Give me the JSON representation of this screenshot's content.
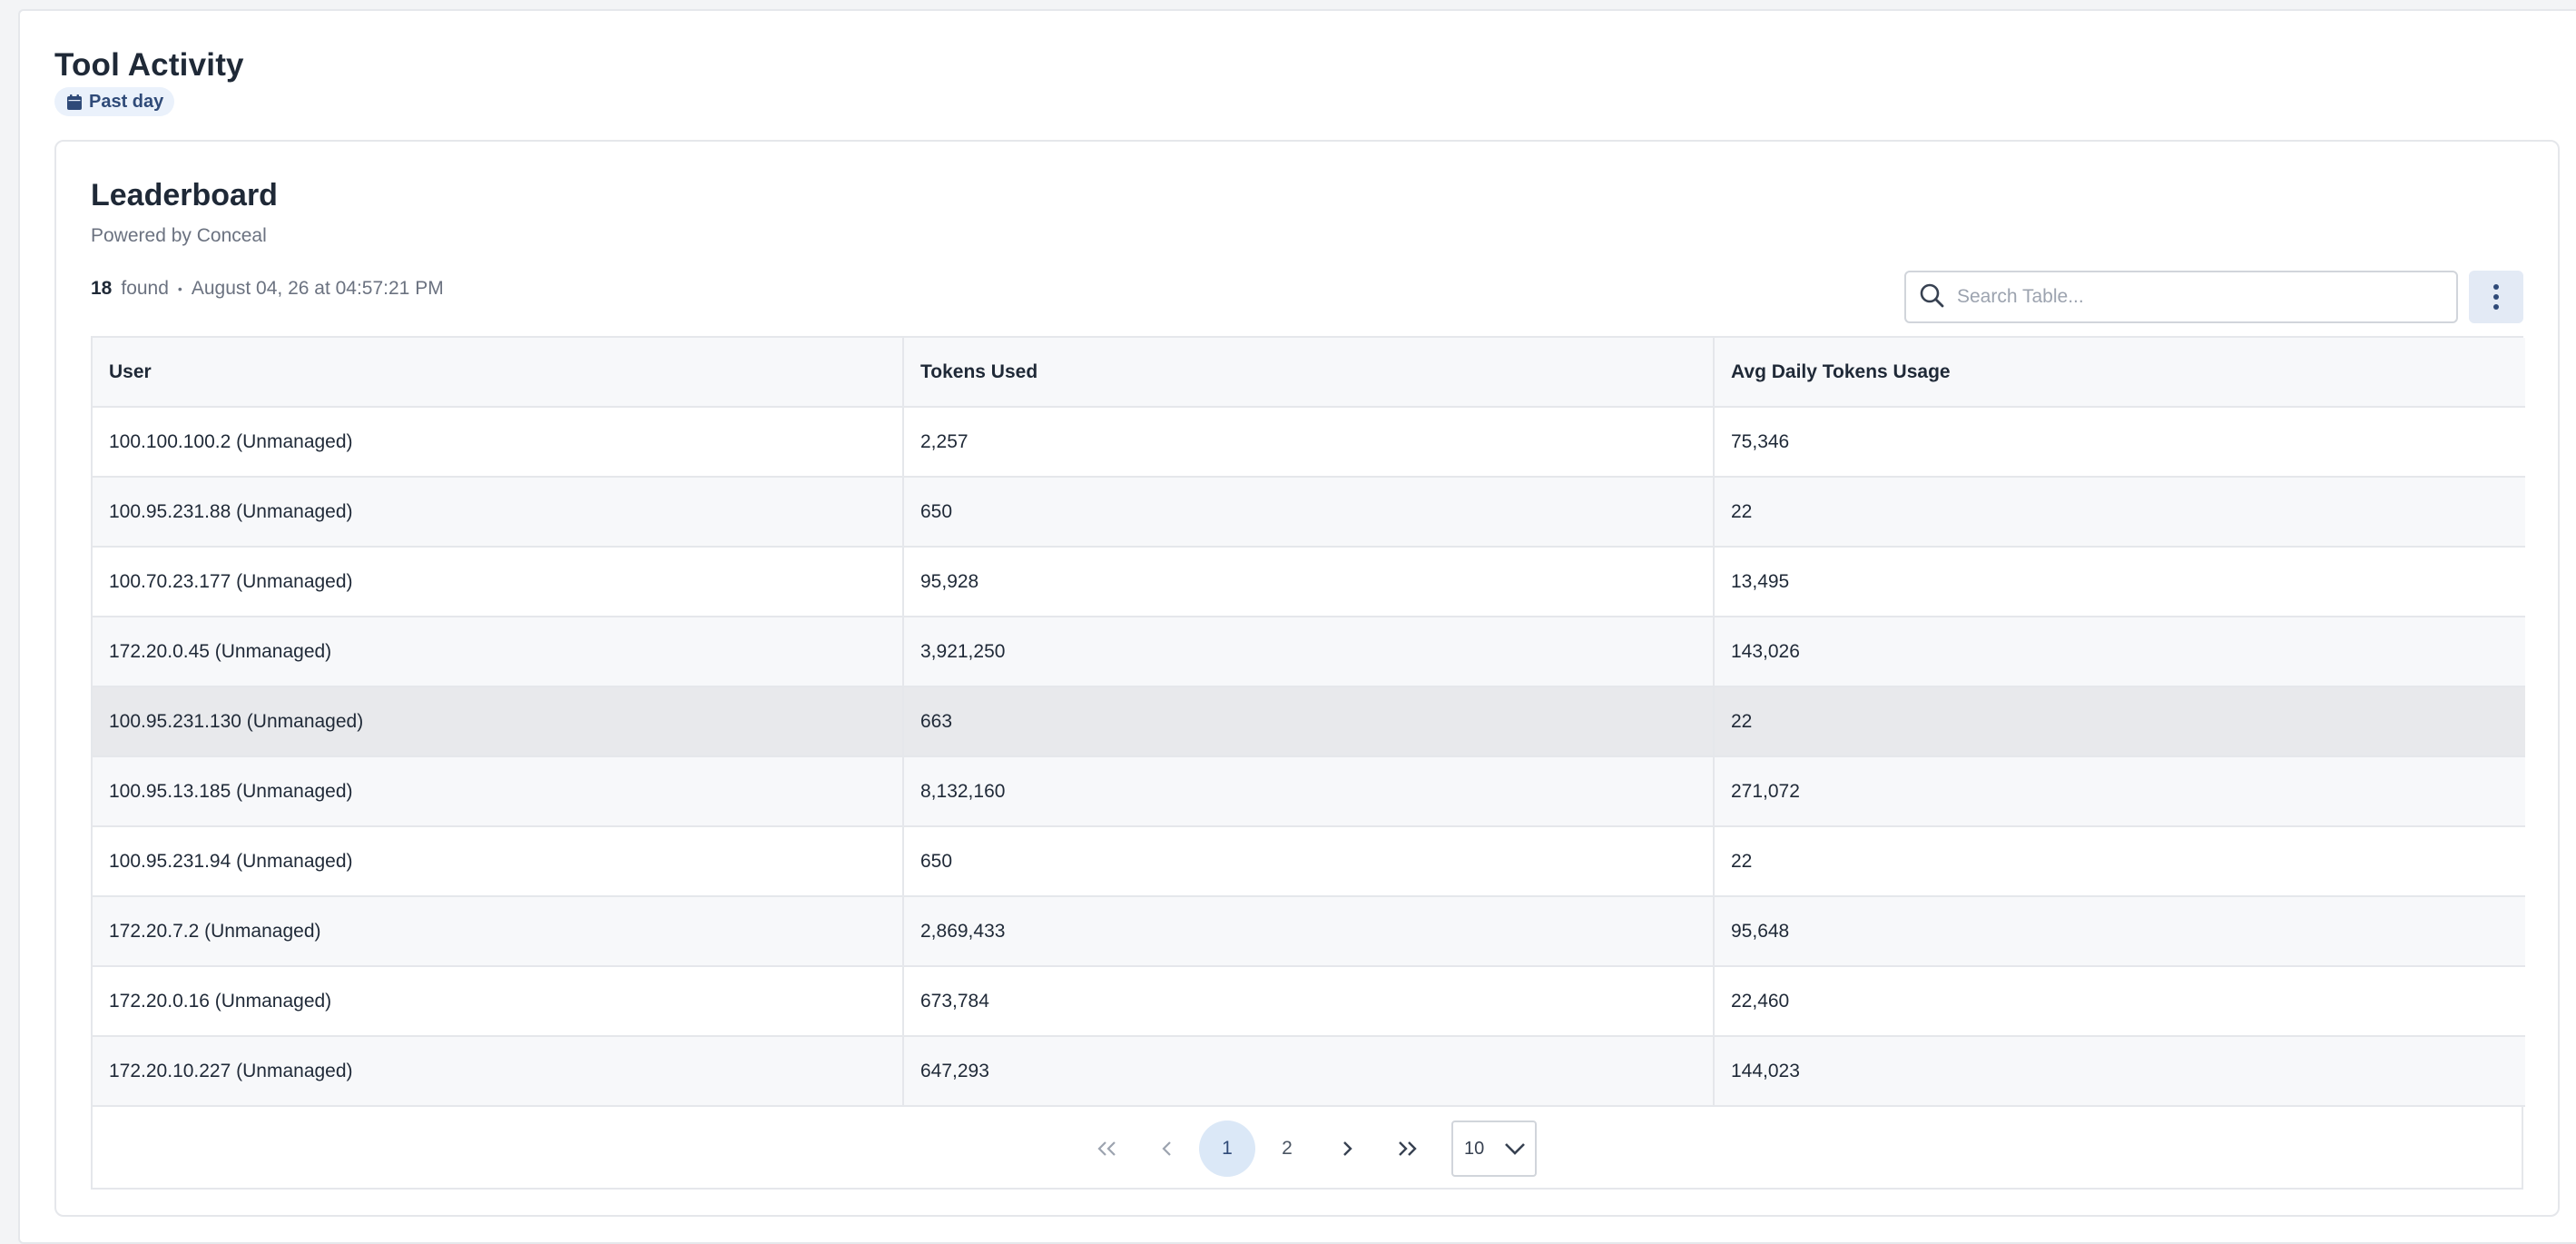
{
  "page": {
    "title": "Tool Activity",
    "range_label": "Past day"
  },
  "leaderboard": {
    "title": "Leaderboard",
    "subtitle": "Powered by Conceal",
    "count": "18",
    "found_label": "found",
    "separator": "•",
    "timestamp": "August 04, 26 at 04:57:21 PM"
  },
  "search": {
    "placeholder": "Search Table..."
  },
  "table": {
    "columns": [
      "User",
      "Tokens Used",
      "Avg Daily Tokens Usage"
    ],
    "rows": [
      [
        "100.100.100.2 (Unmanaged)",
        "2,257",
        "75,346"
      ],
      [
        "100.95.231.88 (Unmanaged)",
        "650",
        "22"
      ],
      [
        "100.70.23.177 (Unmanaged)",
        "95,928",
        "13,495"
      ],
      [
        "172.20.0.45 (Unmanaged)",
        "3,921,250",
        "143,026"
      ],
      [
        "100.95.231.130 (Unmanaged)",
        "663",
        "22"
      ],
      [
        "100.95.13.185 (Unmanaged)",
        "8,132,160",
        "271,072"
      ],
      [
        "100.95.231.94 (Unmanaged)",
        "650",
        "22"
      ],
      [
        "172.20.7.2 (Unmanaged)",
        "2,869,433",
        "95,648"
      ],
      [
        "172.20.0.16 (Unmanaged)",
        "673,784",
        "22,460"
      ],
      [
        "172.20.10.227 (Unmanaged)",
        "647,293",
        "144,023"
      ]
    ],
    "highlighted_row": 4
  },
  "pagination": {
    "pages": [
      "1",
      "2"
    ],
    "current_page": "1",
    "page_size": "10"
  },
  "colors": {
    "accent": "#2f4a78",
    "badge_bg": "#eaf1fb",
    "active_page_bg": "#dbe8f7",
    "border": "#e5e7eb"
  },
  "icons": {
    "range": "calendar-icon",
    "search": "search-icon",
    "menu": "kebab-menu-icon",
    "first": "double-chevron-left-icon",
    "prev": "chevron-left-icon",
    "next": "chevron-right-icon",
    "last": "double-chevron-right-icon",
    "select": "chevron-down-icon"
  }
}
